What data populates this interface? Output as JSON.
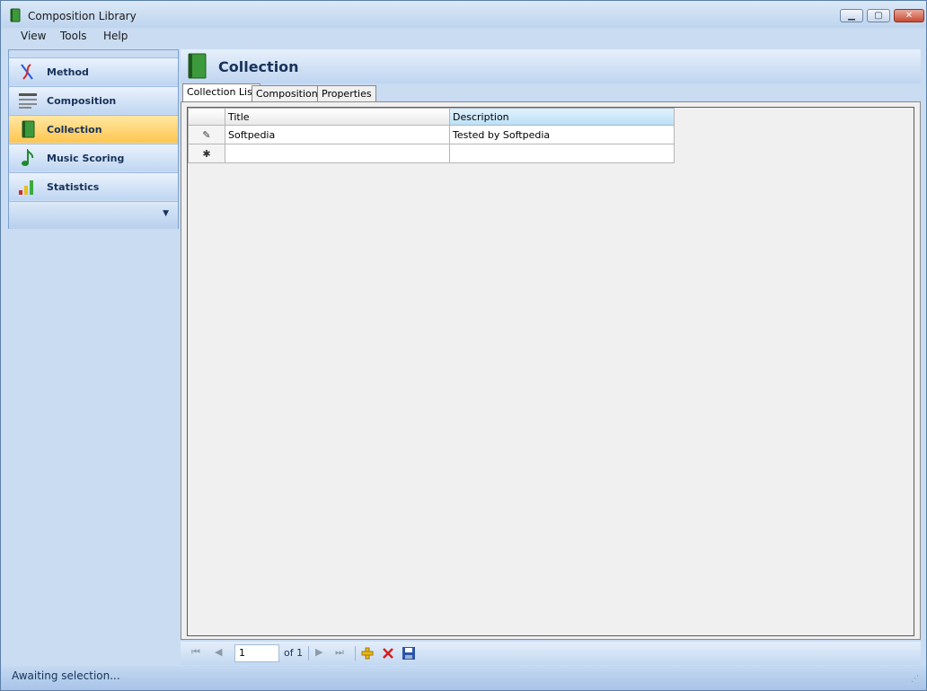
{
  "window": {
    "title": "Composition Library"
  },
  "menu": [
    "View",
    "Tools",
    "Help"
  ],
  "sidebar": {
    "items": [
      {
        "label": "Method",
        "icon": "method-icon"
      },
      {
        "label": "Composition",
        "icon": "composition-icon"
      },
      {
        "label": "Collection",
        "icon": "book-icon",
        "active": true
      },
      {
        "label": "Music Scoring",
        "icon": "music-note-icon"
      },
      {
        "label": "Statistics",
        "icon": "bar-chart-icon"
      }
    ]
  },
  "header": {
    "title": "Collection"
  },
  "tabs": [
    {
      "label": "Collection List",
      "active": true
    },
    {
      "label": "Compositions"
    },
    {
      "label": "Properties"
    }
  ],
  "grid": {
    "columns": [
      "Title",
      "Description"
    ],
    "rows": [
      {
        "indicator": "✎",
        "title": "Softpedia",
        "description": "Tested by Softpedia"
      },
      {
        "indicator": "✱",
        "title": "",
        "description": ""
      }
    ]
  },
  "navigator": {
    "page": "1",
    "of_label": "of 1"
  },
  "status": {
    "text": "Awaiting selection..."
  },
  "colors": {
    "accent": "#17325a",
    "active_item": "#ffc64f",
    "frame": "#c9dcf2"
  }
}
